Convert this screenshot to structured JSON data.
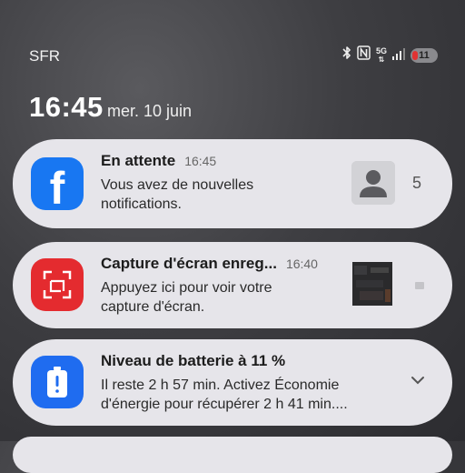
{
  "status_bar": {
    "carrier": "SFR",
    "network_label": "5G",
    "battery_level": "11",
    "icons": [
      "bluetooth-icon",
      "nfc-icon",
      "5g-icon",
      "signal-icon",
      "battery-icon"
    ]
  },
  "lockscreen": {
    "time": "16:45",
    "date": "mer. 10 juin"
  },
  "notifications": [
    {
      "app_icon": "facebook-icon",
      "title": "En attente",
      "time": "16:45",
      "body_line1": "Vous avez de nouvelles",
      "body_line2": "notifications.",
      "count": "5",
      "accent": "#1877f2"
    },
    {
      "app_icon": "screenshot-icon",
      "title": "Capture d'écran enreg...",
      "time": "16:40",
      "body_line1": "Appuyez ici pour voir votre",
      "body_line2": "capture d'écran.",
      "accent": "#e42b2f"
    },
    {
      "app_icon": "battery-alert-icon",
      "title": "Niveau de batterie à 11 %",
      "body_line1": "Il reste 2 h 57 min. Activez Économie",
      "body_line2": "d'énergie pour récupérer 2 h 41 min....",
      "accent": "#1f6cf0"
    }
  ]
}
